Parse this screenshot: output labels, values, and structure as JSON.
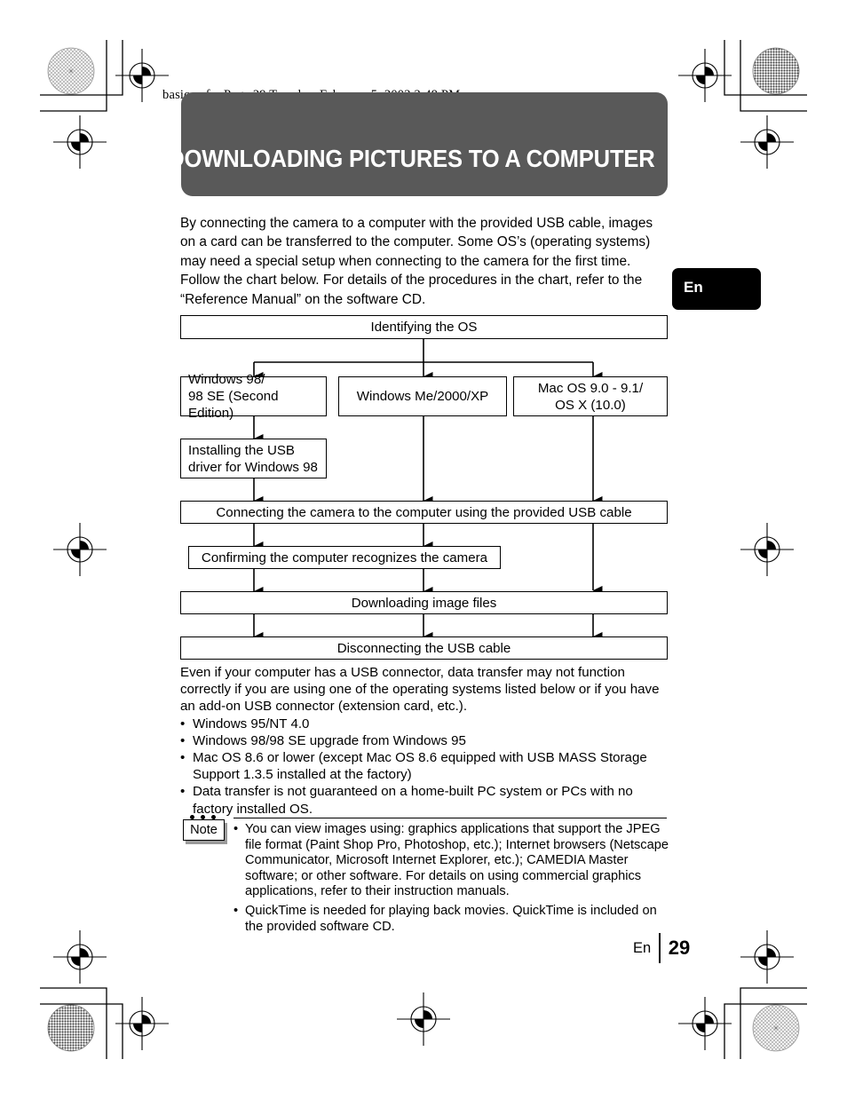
{
  "running_head": "basic_e.fm  Page 29  Tuesday, February 5, 2002  2:48 PM",
  "title_banner": {
    "text": "DOWNLOADING PICTURES TO A COMPUTER",
    "background_color": "#595959",
    "text_color": "#ffffff"
  },
  "language_tab": {
    "label": "En",
    "background_color": "#000000",
    "text_color": "#ffffff"
  },
  "intro_paragraph": "By connecting the camera to a computer with the provided USB cable, images on a card can be transferred to the computer. Some OS’s (operating systems) may need a special setup when connecting to the camera for the first time. Follow the chart below. For details of the procedures in the chart, refer to the “Reference Manual” on the software CD.",
  "flowchart": {
    "boxes": [
      {
        "id": "identify-os",
        "label": "Identifying the OS"
      },
      {
        "id": "win98",
        "label": "Windows 98/\n98 SE (Second Edition)"
      },
      {
        "id": "winme",
        "label": "Windows Me/2000/XP"
      },
      {
        "id": "macos",
        "label": "Mac OS 9.0 - 9.1/\nOS X (10.0)"
      },
      {
        "id": "install-usb",
        "label": "Installing the USB\ndriver for Windows 98"
      },
      {
        "id": "connecting",
        "label": "Connecting the camera to the computer using the provided USB cable"
      },
      {
        "id": "confirming",
        "label": "Confirming the computer recognizes the camera"
      },
      {
        "id": "downloading",
        "label": "Downloading image files"
      },
      {
        "id": "disconnecting",
        "label": "Disconnecting the USB cable"
      }
    ]
  },
  "notice": {
    "paragraph": "Even if your computer has a USB connector, data transfer may not function correctly if you are using one of the operating systems listed below or if you have an add-on USB connector (extension card, etc.).",
    "bullet_char": "•",
    "bullets": [
      "Windows 95/NT 4.0",
      "Windows 98/98 SE upgrade from Windows 95",
      "Mac OS 8.6 or lower (except Mac OS 8.6 equipped with USB MASS Storage Support 1.3.5 installed at the factory)",
      "Data transfer is not guaranteed on a home-built PC system or PCs with no factory installed OS."
    ]
  },
  "note": {
    "badge_label": "Note",
    "bullet_char": "•",
    "bullets": [
      "You can view images using: graphics applications that support the JPEG file format (Paint Shop Pro, Photoshop, etc.); Internet browsers (Netscape Communicator, Microsoft Internet Explorer, etc.); CAMEDIA Master software; or other software. For details on using commercial graphics applications, refer to their instruction manuals.",
      "QuickTime is needed for playing back movies. QuickTime is included on the provided software CD."
    ]
  },
  "footer": {
    "language": "En",
    "page_number": "29"
  }
}
